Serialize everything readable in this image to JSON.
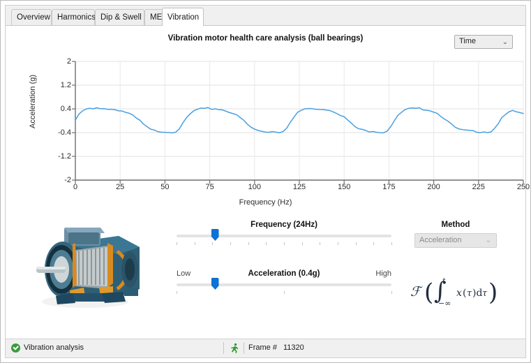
{
  "tabs": [
    {
      "label": "Overview",
      "active": false
    },
    {
      "label": "Harmonics",
      "active": false
    },
    {
      "label": "Dip & Swell",
      "active": false
    },
    {
      "label": "MESA",
      "active": false
    },
    {
      "label": "Vibration",
      "active": true
    }
  ],
  "header": {
    "chart_title": "Vibration motor health care analysis (ball bearings)",
    "domain_select_value": "Time",
    "chevron": "⌄"
  },
  "chart_data": {
    "type": "line",
    "title": "Vibration motor health care analysis (ball bearings)",
    "xlabel": "Frequency (Hz)",
    "ylabel": "Acceleration (g)",
    "xlim": [
      0,
      250
    ],
    "ylim": [
      -2,
      2
    ],
    "xticks": [
      0,
      25,
      50,
      75,
      100,
      125,
      150,
      175,
      200,
      225,
      250
    ],
    "yticks": [
      2,
      1.2,
      0.4,
      -0.4,
      -1.2,
      -2
    ],
    "grid": true,
    "legend": "none",
    "line_color": "#4a9fe0",
    "series": [
      {
        "name": "Acceleration",
        "x": [
          0,
          2,
          4,
          6,
          8,
          10,
          12,
          14,
          16,
          18,
          20,
          22,
          24,
          26,
          28,
          30,
          32,
          34,
          36,
          38,
          40,
          42,
          44,
          46,
          48,
          50,
          52,
          54,
          56,
          58,
          60,
          62,
          64,
          66,
          68,
          70,
          72,
          74,
          76,
          78,
          80,
          82,
          84,
          86,
          88,
          90,
          92,
          94,
          96,
          98,
          100,
          102,
          104,
          106,
          108,
          110,
          112,
          114,
          116,
          118,
          120,
          122,
          124,
          126,
          128,
          130,
          132,
          134,
          136,
          138,
          140,
          142,
          144,
          146,
          148,
          150,
          152,
          154,
          156,
          158,
          160,
          162,
          164,
          166,
          168,
          170,
          172,
          174,
          176,
          178,
          180,
          182,
          184,
          186,
          188,
          190,
          192,
          194,
          196,
          198,
          200,
          202,
          204,
          206,
          208,
          210,
          212,
          214,
          216,
          218,
          220,
          222,
          224,
          226,
          228,
          230,
          232,
          234,
          236,
          238,
          240,
          242,
          244,
          246,
          248,
          250
        ],
        "y": [
          0.02,
          0.2,
          0.33,
          0.38,
          0.41,
          0.39,
          0.42,
          0.4,
          0.43,
          0.4,
          0.39,
          0.38,
          0.36,
          0.33,
          0.29,
          0.24,
          0.17,
          0.08,
          0.0,
          -0.12,
          -0.22,
          -0.3,
          -0.33,
          -0.35,
          -0.36,
          -0.37,
          -0.38,
          -0.38,
          -0.36,
          -0.26,
          -0.1,
          0.08,
          0.22,
          0.32,
          0.38,
          0.41,
          0.39,
          0.42,
          0.4,
          0.41,
          0.39,
          0.37,
          0.34,
          0.3,
          0.25,
          0.18,
          0.1,
          0.0,
          -0.12,
          -0.22,
          -0.29,
          -0.33,
          -0.35,
          -0.37,
          -0.37,
          -0.36,
          -0.37,
          -0.38,
          -0.34,
          -0.22,
          -0.05,
          0.12,
          0.26,
          0.35,
          0.4,
          0.41,
          0.39,
          0.41,
          0.4,
          0.4,
          0.38,
          0.36,
          0.32,
          0.27,
          0.2,
          0.12,
          0.02,
          -0.1,
          -0.2,
          -0.27,
          -0.31,
          -0.34,
          -0.35,
          -0.34,
          -0.36,
          -0.38,
          -0.39,
          -0.33,
          -0.18,
          0.0,
          0.16,
          0.28,
          0.36,
          0.4,
          0.41,
          0.4,
          0.41,
          0.39,
          0.38,
          0.35,
          0.31,
          0.25,
          0.17,
          0.08,
          -0.03,
          -0.14,
          -0.23,
          -0.29,
          -0.32,
          -0.34,
          -0.33,
          -0.35,
          -0.36,
          -0.37,
          -0.36,
          -0.38,
          -0.36,
          -0.25,
          -0.08,
          0.08,
          0.2,
          0.28,
          0.32,
          0.3,
          0.28,
          0.22,
          0.16,
          0.12
        ]
      }
    ]
  },
  "controls": {
    "frequency": {
      "caption": "Frequency (24Hz)",
      "value_pct": 18,
      "tick_count": 13
    },
    "acceleration": {
      "caption": "Acceleration (0.4g)",
      "low_label": "Low",
      "high_label": "High",
      "value_pct": 18,
      "tick_count": 3
    },
    "method": {
      "label": "Method",
      "value": "Acceleration",
      "chevron": "⌄"
    },
    "formula_alt": "F( integral from -infinity to t of x(tau) d tau )",
    "motor_image_alt": "cutaway electric motor"
  },
  "statusbar": {
    "status_text": "Vibration analysis",
    "frame_label": "Frame #",
    "frame_value": "11320"
  }
}
